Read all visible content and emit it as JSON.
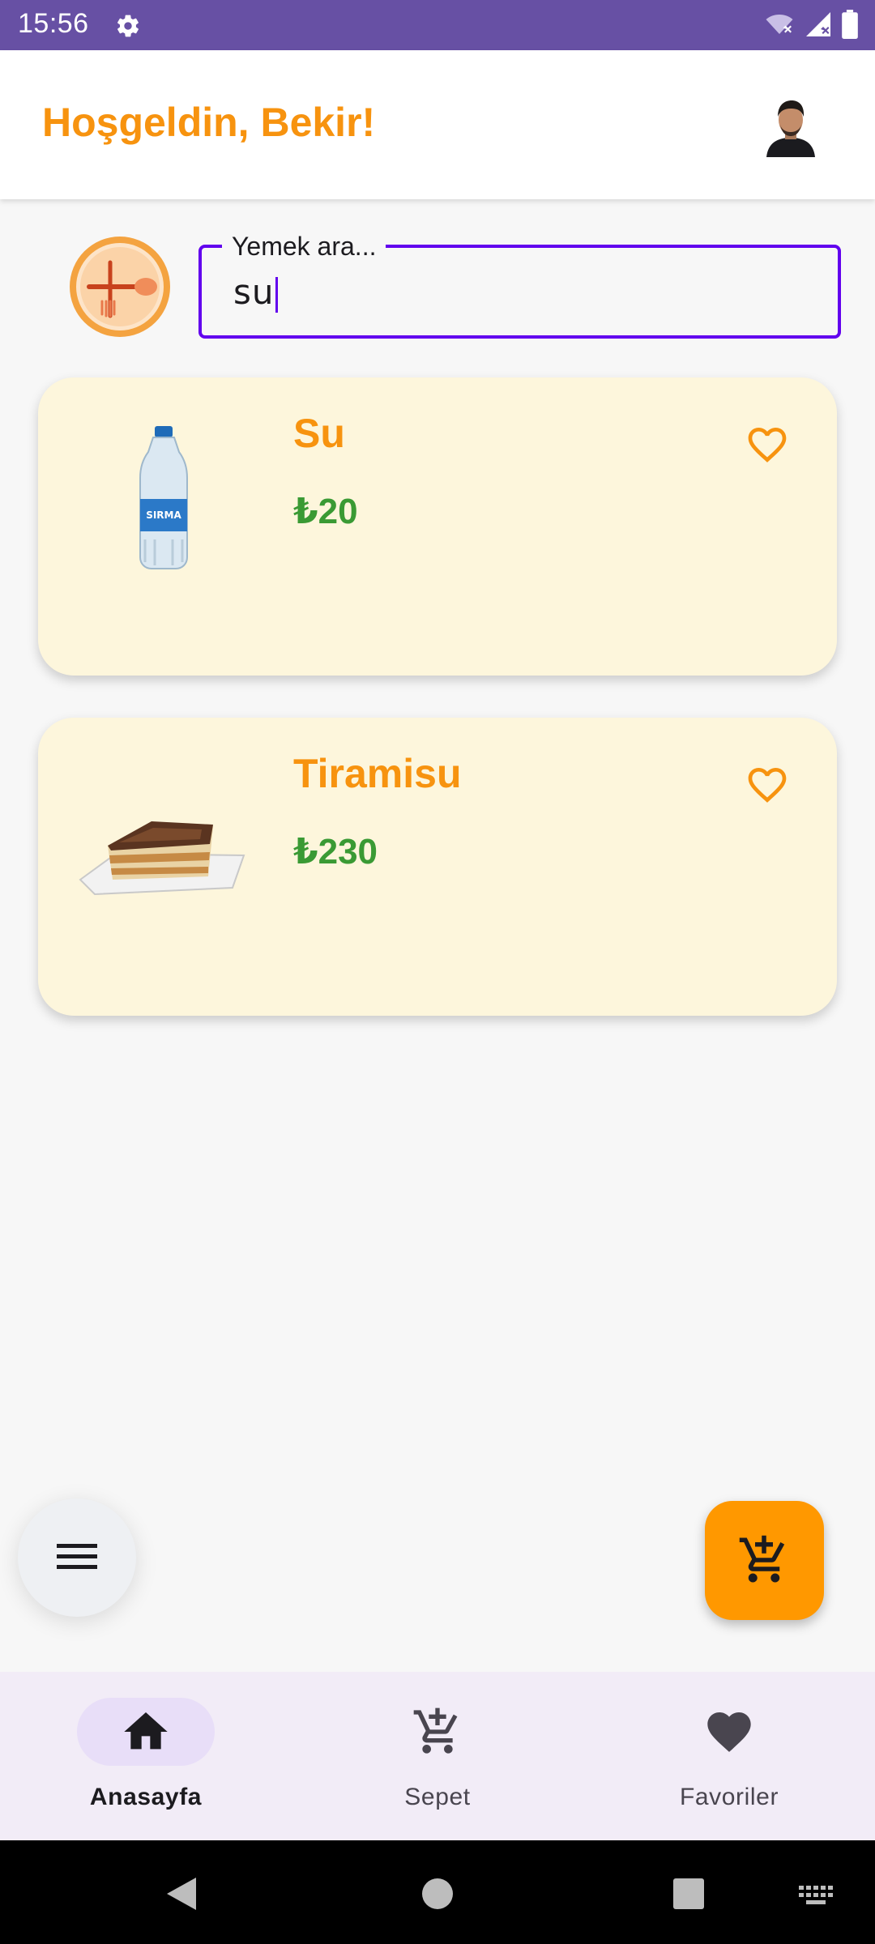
{
  "status_bar": {
    "time": "15:56",
    "icons": [
      "settings-icon",
      "wifi-off-icon",
      "signal-icon",
      "battery-icon"
    ],
    "background": "#6750a4"
  },
  "header": {
    "title": "Hoşgeldin, Bekir!",
    "title_color": "#f7930f",
    "avatar": "user-avatar"
  },
  "search": {
    "label": "Yemek ara...",
    "value": "su",
    "border_color": "#6200ee"
  },
  "results": [
    {
      "name": "Su",
      "price": "₺20",
      "image": "water-bottle",
      "favorite": false
    },
    {
      "name": "Tiramisu",
      "price": "₺230",
      "image": "tiramisu",
      "favorite": false
    }
  ],
  "colors": {
    "accent": "#f7930f",
    "price": "#3a9a34",
    "card_bg": "#fdf6dc",
    "fab": "#ff9800"
  },
  "fabs": {
    "menu_icon": "menu-icon",
    "cart_icon": "add-to-cart-icon"
  },
  "bottom_nav": {
    "items": [
      {
        "label": "Anasayfa",
        "icon": "home-icon",
        "active": true
      },
      {
        "label": "Sepet",
        "icon": "cart-add-icon",
        "active": false
      },
      {
        "label": "Favoriler",
        "icon": "heart-icon",
        "active": false
      }
    ]
  },
  "system_nav": {
    "icons": [
      "back-icon",
      "home-circle-icon",
      "recents-icon",
      "keyboard-icon"
    ]
  }
}
